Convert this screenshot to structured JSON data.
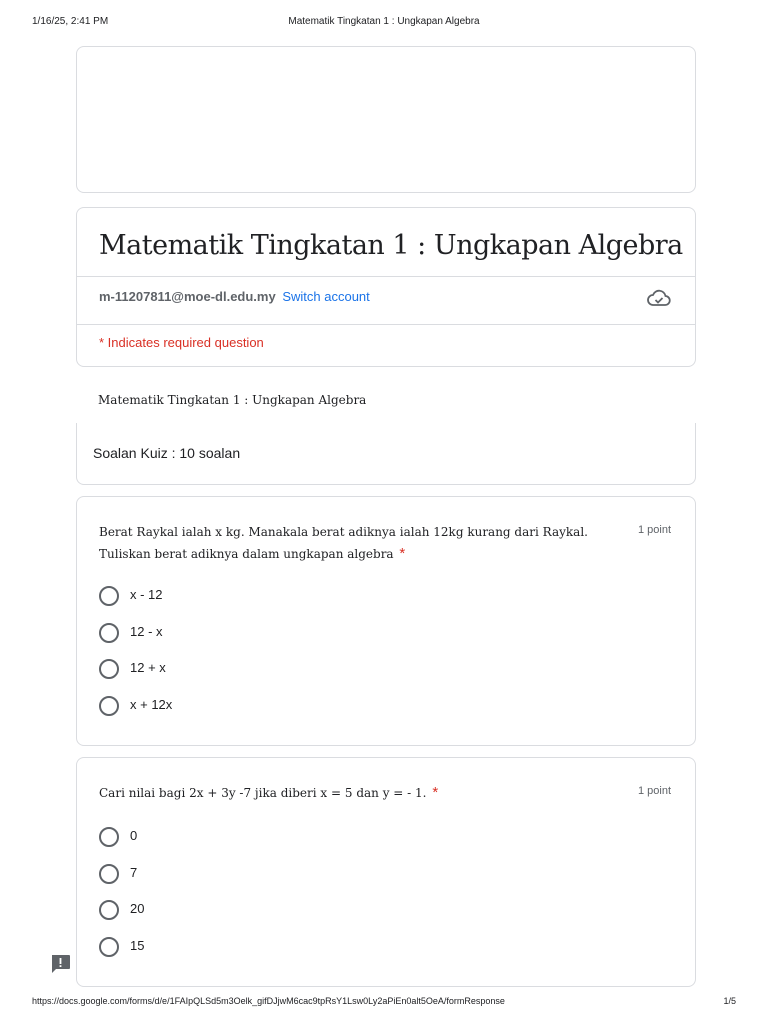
{
  "print_header": {
    "datetime": "1/16/25, 2:41 PM",
    "title": "Matematik Tingkatan 1 : Ungkapan Algebra"
  },
  "form": {
    "title": "Matematik Tingkatan 1 : Ungkapan Algebra",
    "email": "m-11207811@moe-dl.edu.my",
    "switch_account": "Switch account",
    "cloud_icon": "cloud-check-icon",
    "required_note": "* Indicates required question"
  },
  "section": {
    "title": "Matematik Tingkatan 1 : Ungkapan Algebra",
    "description": "Soalan Kuiz : 10 soalan"
  },
  "questions": [
    {
      "text": "Berat Raykal ialah x kg. Manakala berat adiknya ialah 12kg kurang dari Raykal. Tuliskan berat adiknya dalam ungkapan algebra",
      "required_mark": "*",
      "points": "1 point",
      "options": [
        "x - 12",
        "12 - x",
        "12 + x",
        "x + 12x"
      ]
    },
    {
      "text": "Cari nilai bagi 2x + 3y -7 jika diberi x = 5 dan y = - 1.",
      "required_mark": "*",
      "points": "1 point",
      "options": [
        "0",
        "7",
        "20",
        "15"
      ]
    }
  ],
  "print_footer": {
    "url": "https://docs.google.com/forms/d/e/1FAIpQLSd5m3Oelk_gifDJjwM6cac9tpRsY1Lsw0Ly2aPiEn0alt5OeA/formResponse",
    "page": "1/5"
  },
  "icons": {
    "report": "report-issue-icon"
  },
  "colors": {
    "accent_link": "#1a73e8",
    "required_red": "#d93025",
    "border": "#dadce0"
  }
}
